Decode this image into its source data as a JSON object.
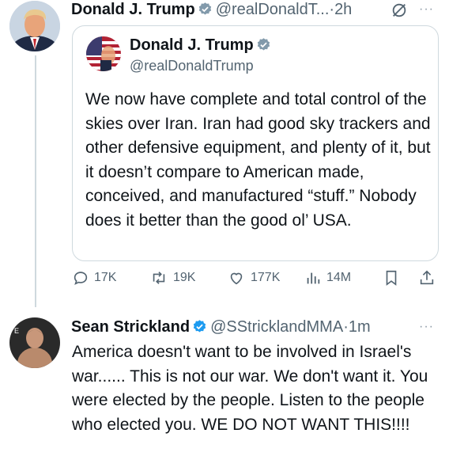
{
  "tweet1": {
    "display_name": "Donald J. Trump",
    "handle": "@realDonaldT...",
    "separator": "·",
    "time": "2h",
    "more_label": "···",
    "quote": {
      "display_name": "Donald J. Trump",
      "handle": "@realDonaldTrump",
      "text": "We now have complete and total control of the skies over Iran. Iran had good sky trackers and other defensive equipment, and plenty of it, but it doesn’t compare to American made, conceived, and manufactured “stuff.” Nobody does it better than the good ol’ USA."
    },
    "actions": {
      "replies": "17K",
      "reposts": "19K",
      "likes": "177K",
      "views": "14M"
    }
  },
  "tweet2": {
    "display_name": "Sean Strickland",
    "handle": "@SStricklandMMA",
    "separator": "·",
    "time": "1m",
    "more_label": "···",
    "text": "America doesn't want to be involved in Israel's war...... This is not our war. We don't want it. You were elected by the people. Listen to the people who elected you. WE DO NOT WANT THIS!!!!"
  },
  "colors": {
    "verified_blue": "#1d9bf0",
    "verified_gold": "#829aab",
    "secondary_text": "#536471",
    "border": "#cfd9de"
  },
  "icons": [
    "verified-badge-icon",
    "grok-icon",
    "reply-icon",
    "repost-icon",
    "like-icon",
    "views-icon",
    "bookmark-icon",
    "share-icon"
  ]
}
